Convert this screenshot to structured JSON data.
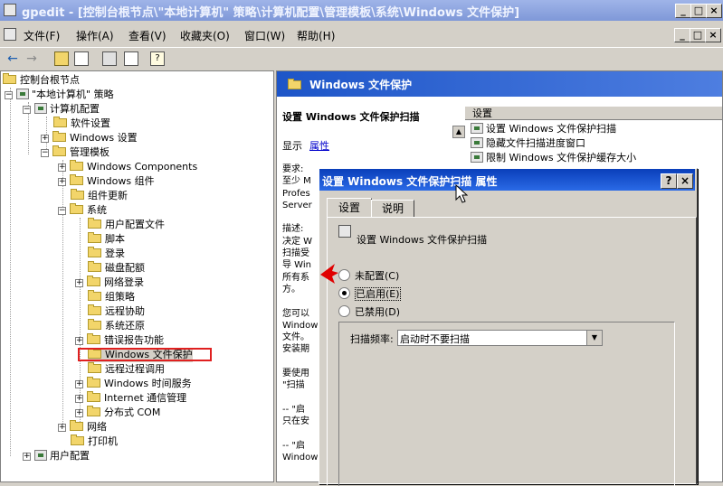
{
  "window": {
    "title": "gpedit - [控制台根节点\\\"本地计算机\" 策略\\计算机配置\\管理模板\\系统\\Windows 文件保护]",
    "min": "_",
    "max": "□",
    "close": "×"
  },
  "menubar": {
    "items": [
      "文件(F)",
      "操作(A)",
      "查看(V)",
      "收藏夹(O)",
      "窗口(W)",
      "帮助(H)"
    ],
    "mdi_min": "_",
    "mdi_max": "□",
    "mdi_close": "×"
  },
  "tree": {
    "root": "控制台根节点",
    "policy": "\"本地计算机\" 策略",
    "computer_config": "计算机配置",
    "software_settings": "软件设置",
    "windows_settings": "Windows 设置",
    "admin_templates": "管理模板",
    "windows_components": "Windows Components",
    "windows_components_cn": "Windows 组件",
    "component_update": "组件更新",
    "system": "系统",
    "system_children": [
      "用户配置文件",
      "脚本",
      "登录",
      "磁盘配额",
      "网络登录",
      "组策略",
      "远程协助",
      "系统还原",
      "错误报告功能",
      "Windows 文件保护",
      "远程过程调用",
      "Windows 时间服务",
      "Internet 通信管理",
      "分布式 COM"
    ],
    "network": "网络",
    "printers": "打印机",
    "user_config": "用户配置"
  },
  "right": {
    "header": "Windows 文件保护",
    "policy_title": "设置 Windows 文件保护扫描",
    "display_label": "显示",
    "properties_link": "属性",
    "desc_lines": [
      "要求:",
      "至少 M",
      "Profes",
      "Server",
      "",
      "描述:",
      "决定 W",
      "扫描受",
      "导 Win",
      "所有系",
      "方。",
      "",
      "您可以",
      "Window",
      "文件。",
      "安装期",
      "",
      "要使用",
      "\"扫描",
      "",
      "-- \"启",
      "只在安",
      "",
      "-- \"启",
      "Window"
    ],
    "list_header": "设置",
    "list_items": [
      "设置 Windows 文件保护扫描",
      "隐藏文件扫描进度窗口",
      "限制 Windows 文件保护缓存大小"
    ]
  },
  "dialog": {
    "title": "设置 Windows 文件保护扫描 属性",
    "help": "?",
    "close": "×",
    "tabs": [
      "设置",
      "说明"
    ],
    "setting_name": "设置 Windows 文件保护扫描",
    "radio_not_configured": "未配置(C)",
    "radio_enabled": "已启用(E)",
    "radio_disabled": "已禁用(D)",
    "scan_label": "扫描频率:",
    "scan_value": "启动时不要扫描"
  },
  "colors": {
    "highlight_box": "#e02020",
    "arrow": "#e00000"
  }
}
